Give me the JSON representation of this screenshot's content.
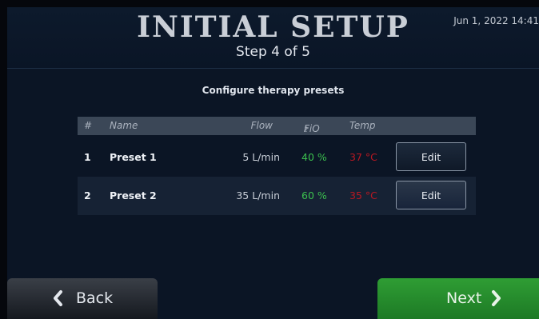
{
  "header": {
    "title": "INITIAL SETUP",
    "step": "Step 4 of 5",
    "datetime": "Jun 1, 2022 14:41"
  },
  "subtitle": "Configure therapy presets",
  "table": {
    "columns": {
      "num": "#",
      "name": "Name",
      "flow": "Flow",
      "fio2_base": "FiO",
      "fio2_sub": "2",
      "temp": "Temp"
    },
    "rows": [
      {
        "num": "1",
        "name": "Preset 1",
        "flow": "5 L/min",
        "fio2": "40 %",
        "temp": "37 °C",
        "action": "Edit"
      },
      {
        "num": "2",
        "name": "Preset 2",
        "flow": "35 L/min",
        "fio2": "60 %",
        "temp": "35 °C",
        "action": "Edit"
      }
    ]
  },
  "nav": {
    "back_label": "Back",
    "next_label": "Next"
  },
  "colors": {
    "fio2": "#3bbf4e",
    "temp": "#b81822",
    "next_button": "#2f9d34"
  },
  "icons": {
    "back": "chevron-left-icon",
    "next": "chevron-right-icon"
  }
}
